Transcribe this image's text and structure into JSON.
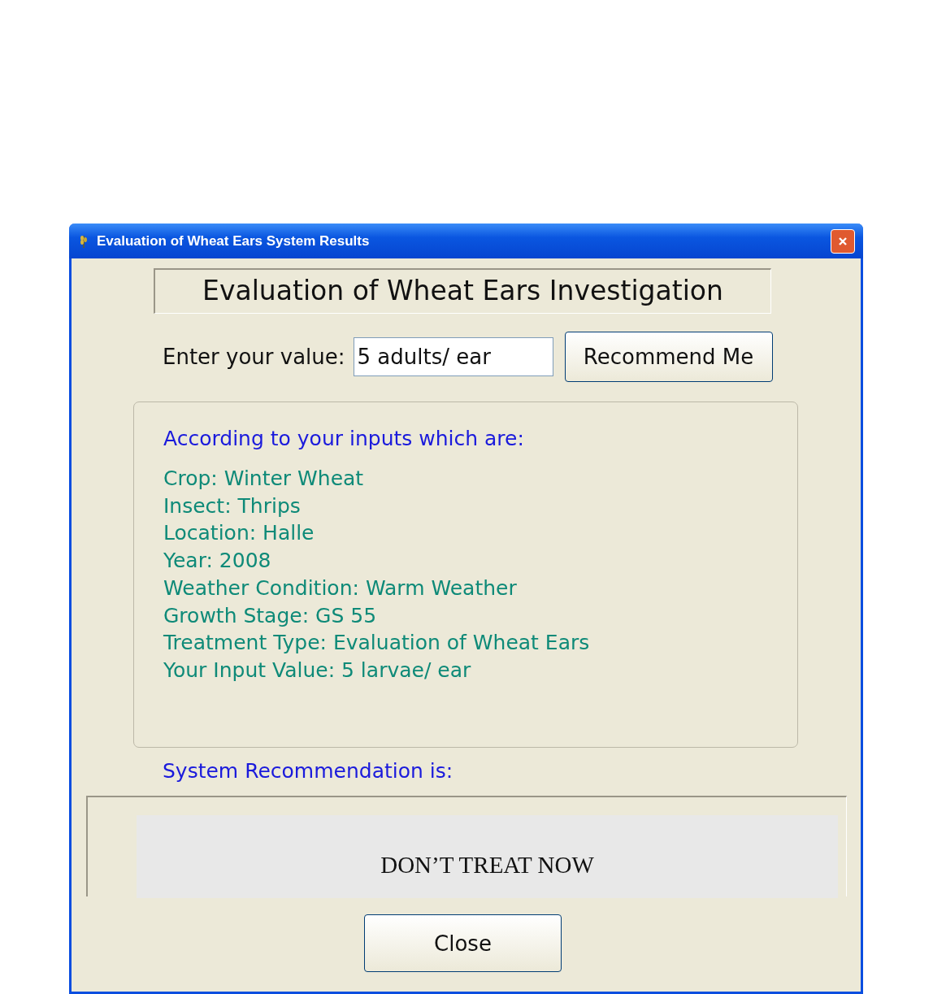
{
  "window": {
    "title": "Evaluation of Wheat Ears System Results"
  },
  "heading": "Evaluation of Wheat Ears Investigation",
  "input": {
    "label": "Enter your value:",
    "value": "5 adults/ ear"
  },
  "recommend_button": "Recommend Me",
  "inputs_panel": {
    "intro": "According to your inputs which are:",
    "lines": [
      "Crop: Winter Wheat",
      "Insect: Thrips",
      "Location: Halle",
      "Year: 2008",
      "Weather Condition: Warm Weather",
      "Growth Stage: GS 55",
      "Treatment Type: Evaluation of Wheat Ears",
      "Your Input Value: 5 larvae/ ear"
    ]
  },
  "recommendation": {
    "label": "System Recommendation is:",
    "result": "DON’T TREAT NOW"
  },
  "close_button": "Close"
}
